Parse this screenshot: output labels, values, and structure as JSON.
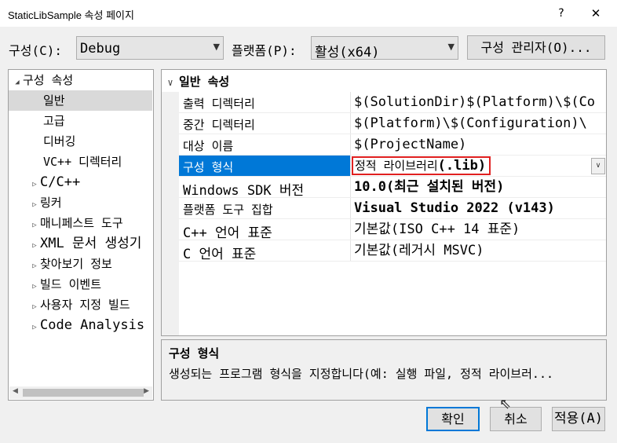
{
  "window": {
    "title": "StaticLibSample 속성 페이지",
    "help": "?",
    "close": "✕"
  },
  "config": {
    "label": "구성(C):",
    "value": "Debug"
  },
  "platform": {
    "label": "플랫폼(P):",
    "value": "활성(x64)"
  },
  "config_manager_label": "구성 관리자(O)...",
  "tree": {
    "items": [
      {
        "label": "구성 속성",
        "arrow": "◢"
      },
      {
        "label": "일반"
      },
      {
        "label": "고급"
      },
      {
        "label": "디버깅"
      },
      {
        "label": "VC++ 디렉터리"
      },
      {
        "label": "C/C++",
        "arrow": "▷"
      },
      {
        "label": "링커",
        "arrow": "▷"
      },
      {
        "label": "매니페스트 도구",
        "arrow": "▷"
      },
      {
        "label": "XML 문서 생성기",
        "arrow": "▷"
      },
      {
        "label": "찾아보기 정보",
        "arrow": "▷"
      },
      {
        "label": "빌드 이벤트",
        "arrow": "▷"
      },
      {
        "label": "사용자 지정 빌드",
        "arrow": "▷"
      },
      {
        "label": "Code Analysis",
        "arrow": "▷"
      }
    ]
  },
  "grid": {
    "category": "일반 속성",
    "category_chevron": "∨",
    "rows": [
      {
        "name": "출력 디렉터리",
        "value": "$(SolutionDir)$(Platform)\\$(Co"
      },
      {
        "name": "중간 디렉터리",
        "value": "$(Platform)\\$(Configuration)\\"
      },
      {
        "name": "대상 이름",
        "value": "$(ProjectName)"
      },
      {
        "name": "구성 형식",
        "value_main": "정적 라이브러리",
        "value_ext": "(.lib)",
        "dropdown": "∨"
      },
      {
        "name": "Windows SDK 버전",
        "value": "10.0(최근 설치된 버전)"
      },
      {
        "name": "플랫폼 도구 집합",
        "value": "Visual Studio 2022 (v143)"
      },
      {
        "name": "C++ 언어 표준",
        "value": "기본값(ISO C++ 14 표준)"
      },
      {
        "name": "C 언어 표준",
        "value": "기본값(레거시 MSVC)"
      }
    ]
  },
  "description": {
    "title": "구성 형식",
    "text": "생성되는 프로그램 형식을 지정합니다(예: 실행 파일, 정적 라이브러..."
  },
  "buttons": {
    "ok": "확인",
    "cancel": "취소",
    "apply": "적용(A)"
  },
  "colors": {
    "selection": "#0078d7",
    "highlight_box": "#e02020",
    "focus_border": "#0078d7"
  }
}
